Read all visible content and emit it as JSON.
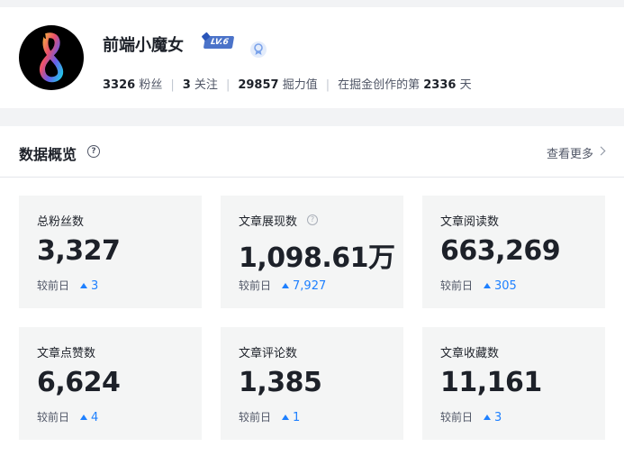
{
  "profile": {
    "username": "前端小魔女",
    "level_badge": "LV.6",
    "followers_count": "3326",
    "followers_label": "粉丝",
    "following_count": "3",
    "following_label": "关注",
    "power_count": "29857",
    "power_label": "掘力值",
    "days_prefix": "在掘金创作的第",
    "days_count": "2336",
    "days_suffix": "天"
  },
  "overview": {
    "title": "数据概览",
    "help_glyph": "?",
    "more_label": "查看更多",
    "compare_label": "较前日",
    "tiles": [
      {
        "label": "总粉丝数",
        "value": "3,327",
        "delta": "3"
      },
      {
        "label": "文章展现数",
        "value": "1,098.61万",
        "delta": "7,927"
      },
      {
        "label": "文章阅读数",
        "value": "663,269",
        "delta": "305"
      },
      {
        "label": "文章点赞数",
        "value": "6,624",
        "delta": "4"
      },
      {
        "label": "文章评论数",
        "value": "1,385",
        "delta": "1"
      },
      {
        "label": "文章收藏数",
        "value": "11,161",
        "delta": "3"
      }
    ]
  },
  "colors": {
    "accent": "#1e80ff",
    "page_background": "#f2f3f5",
    "tile_background": "#f4f5f5",
    "level_badge": "#4b73c9"
  },
  "icons": {
    "avatar": "rainbow-figure-eight-logo",
    "vip": "blue-medal-icon",
    "help": "question-circle-icon",
    "more": "chevron-right-icon",
    "trend": "triangle-up-icon"
  }
}
